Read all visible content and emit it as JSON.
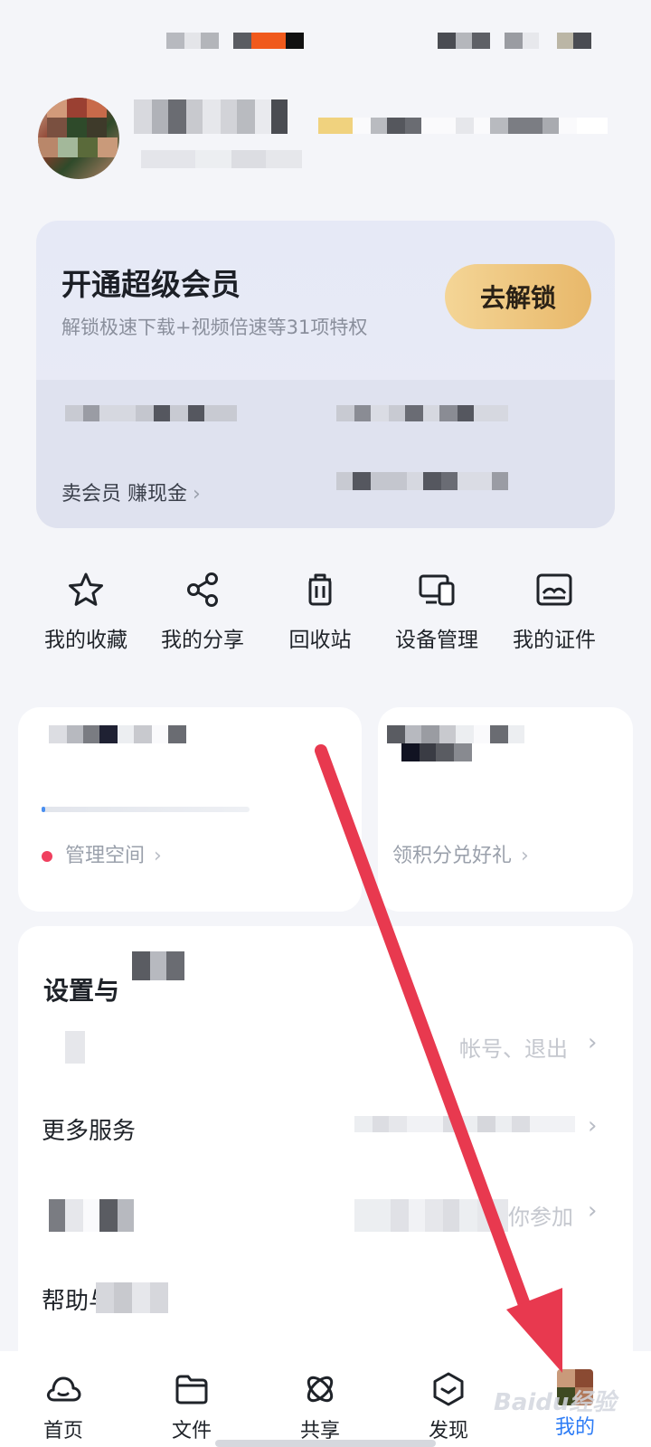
{
  "vip": {
    "title": "开通超级会员",
    "subtitle": "解锁极速下载+视频倍速等31项特权",
    "unlock_button": "去解锁",
    "sell_link": "卖会员 赚现金",
    "sell_chevron": "›"
  },
  "quick_actions": [
    {
      "label": "我的收藏",
      "icon": "star-icon"
    },
    {
      "label": "我的分享",
      "icon": "share-icon"
    },
    {
      "label": "回收站",
      "icon": "trash-icon"
    },
    {
      "label": "设备管理",
      "icon": "devices-icon"
    },
    {
      "label": "我的证件",
      "icon": "id-card-icon"
    }
  ],
  "storage": {
    "manage_link": "管理空间",
    "chevron": "›"
  },
  "points": {
    "redeem_link": "领积分兑好礼",
    "chevron": "›"
  },
  "settings": {
    "heading": "设置与",
    "account_hint": "帐号、退出",
    "more_services": "更多服务",
    "invite_hint": "你参加",
    "help": "帮助与"
  },
  "tabs": [
    {
      "label": "首页",
      "icon": "cloud-home-icon"
    },
    {
      "label": "文件",
      "icon": "folder-icon"
    },
    {
      "label": "共享",
      "icon": "share-orbit-icon"
    },
    {
      "label": "发现",
      "icon": "discover-icon"
    },
    {
      "label": "我的",
      "icon": "avatar-icon"
    }
  ],
  "active_tab": "我的",
  "watermark": "Baidu经验",
  "colors": {
    "accent": "#2d7cf6",
    "unlock_gold": "#e8b86a",
    "annotation_arrow": "#e8394f",
    "dot_red": "#f0405f"
  }
}
